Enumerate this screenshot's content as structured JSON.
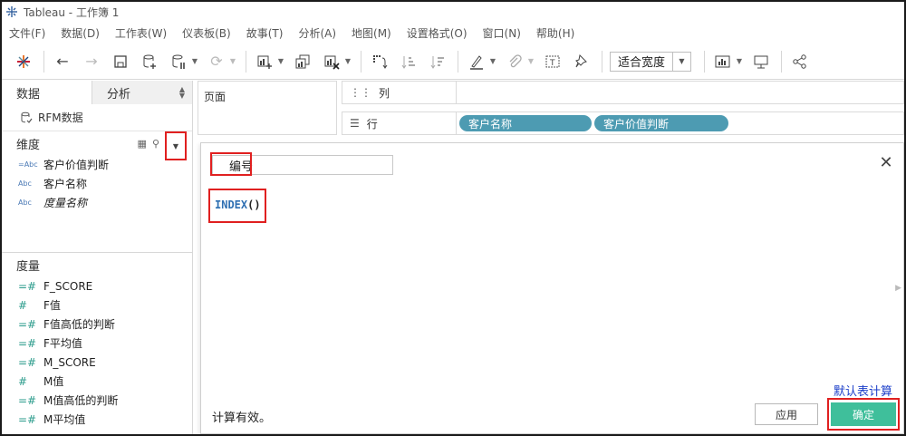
{
  "window": {
    "title": "Tableau - 工作簿 1"
  },
  "menu": [
    "文件(F)",
    "数据(D)",
    "工作表(W)",
    "仪表板(B)",
    "故事(T)",
    "分析(A)",
    "地图(M)",
    "设置格式(O)",
    "窗口(N)",
    "帮助(H)"
  ],
  "toolbar": {
    "fit_label": "适合宽度"
  },
  "left_pane": {
    "tabs": {
      "data": "数据",
      "analysis": "分析"
    },
    "datasource": "RFM数据",
    "dimensions_title": "维度",
    "dimensions": [
      {
        "type": "=Abc",
        "name": "客户价值判断",
        "italic": false
      },
      {
        "type": "Abc",
        "name": "客户名称",
        "italic": false
      },
      {
        "type": "Abc",
        "name": "度量名称",
        "italic": true
      }
    ],
    "measures_title": "度量",
    "measures": [
      {
        "type": "=#",
        "name": "F_SCORE"
      },
      {
        "type": "#",
        "name": "F值"
      },
      {
        "type": "=#",
        "name": "F值高低的判断"
      },
      {
        "type": "=#",
        "name": "F平均值"
      },
      {
        "type": "=#",
        "name": "M_SCORE"
      },
      {
        "type": "#",
        "name": "M值"
      },
      {
        "type": "=#",
        "name": "M值高低的判断"
      },
      {
        "type": "=#",
        "name": "M平均值"
      }
    ]
  },
  "shelves": {
    "pages_label": "页面",
    "columns_label": "列",
    "rows_label": "行",
    "row_pills": [
      "客户名称",
      "客户价值判断"
    ]
  },
  "calc_dialog": {
    "name": "编号",
    "formula_fn": "INDEX",
    "formula_args": "()",
    "status": "计算有效。",
    "apply_label": "应用",
    "ok_label": "确定",
    "annotation": "默认表计算"
  },
  "colors": {
    "pill": "#4d9bb2",
    "ok_button": "#3fbf9b",
    "highlight": "#e02020",
    "annotation": "#1b3ec9"
  }
}
